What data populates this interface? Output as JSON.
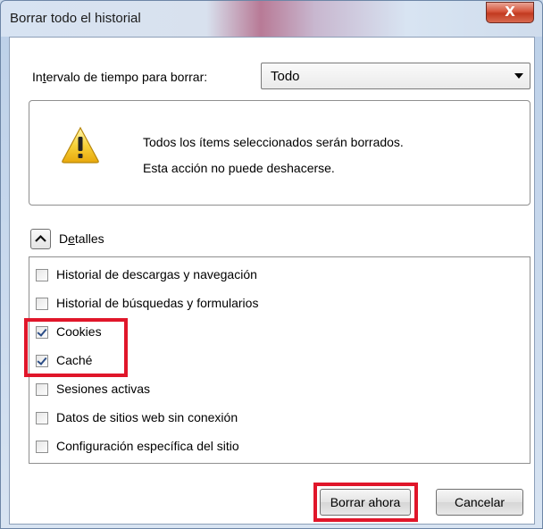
{
  "window": {
    "title": "Borrar todo el historial",
    "close_glyph": "X"
  },
  "interval": {
    "label": "Intervalo de tiempo para borrar:",
    "selected": "Todo"
  },
  "warning": {
    "line1": "Todos los ítems seleccionados serán borrados.",
    "line2": "Esta acción no puede deshacerse."
  },
  "details": {
    "label": "Detalles",
    "expanded": true
  },
  "items": [
    {
      "label": "Historial de descargas y navegación",
      "checked": false
    },
    {
      "label": "Historial de búsquedas y formularios",
      "checked": false
    },
    {
      "label": "Cookies",
      "checked": true
    },
    {
      "label": "Caché",
      "checked": true
    },
    {
      "label": "Sesiones activas",
      "checked": false
    },
    {
      "label": "Datos de sitios web sin conexión",
      "checked": false
    },
    {
      "label": "Configuración específica del sitio",
      "checked": false
    }
  ],
  "buttons": {
    "clear_now": "Borrar ahora",
    "cancel": "Cancelar"
  },
  "colors": {
    "highlight": "#e0162a",
    "checkmark": "#2b4d86"
  }
}
